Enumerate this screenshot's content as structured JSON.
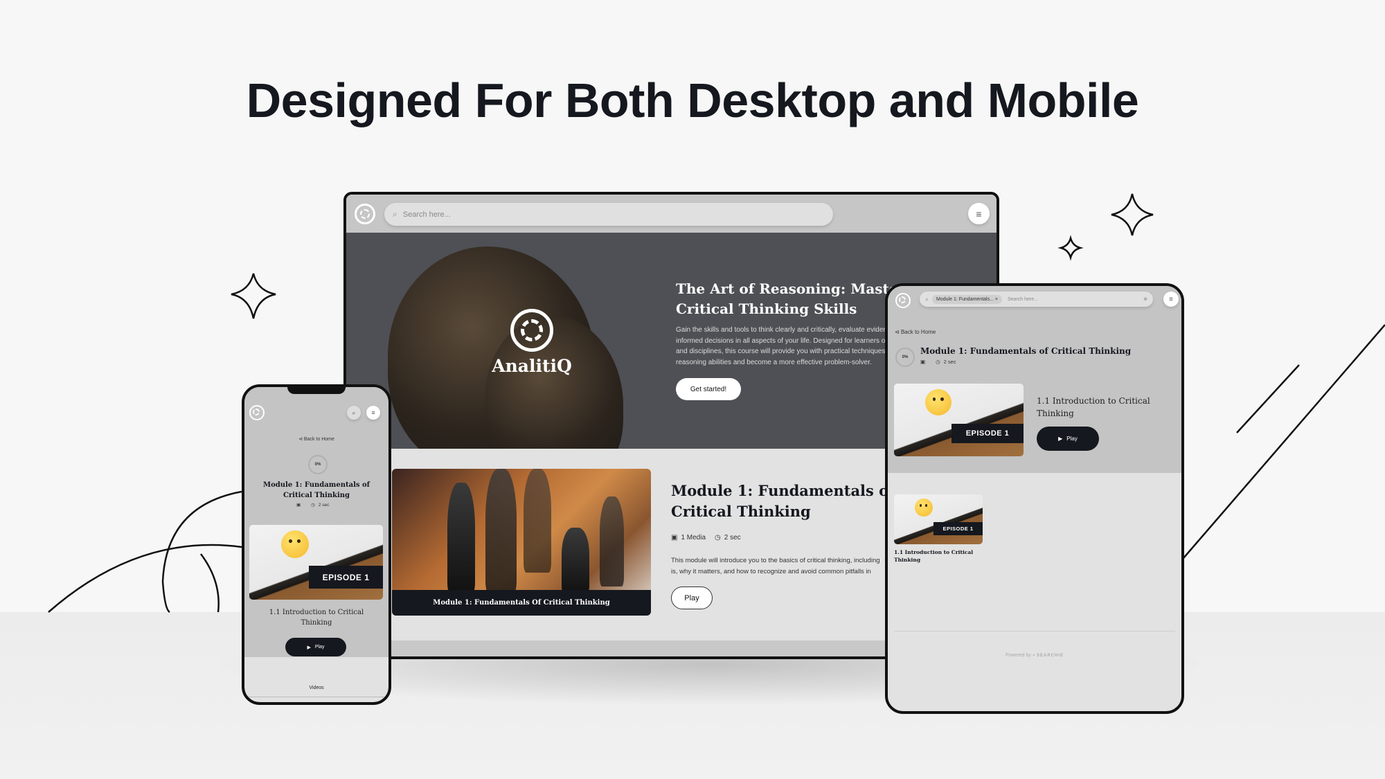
{
  "headline": "Designed For Both Desktop and Mobile",
  "desktop": {
    "search_placeholder": "Search here...",
    "hero": {
      "brand": "AnalitiQ",
      "title_line1": "The Art of Reasoning: Mastering",
      "title_line2": "Critical Thinking Skills",
      "description": [
        "Gain the skills and tools to think clearly and critically, evaluate evidence",
        "informed decisions in all aspects of your life. Designed for learners of all",
        "and disciplines, this course will provide you with practical techniques to",
        "reasoning abilities and become a more effective problem-solver."
      ],
      "cta": "Get started!"
    },
    "module": {
      "image_caption": "Module 1: Fundamentals Of Critical Thinking",
      "title_line1": "Module 1: Fundamentals of",
      "title_line2": "Critical Thinking",
      "media_count": "1 Media",
      "duration": "2 sec",
      "description": [
        "This module will introduce you to the basics of critical thinking, including",
        "is, why it matters, and how to recognize and avoid common pitfalls in"
      ],
      "play": "Play"
    }
  },
  "tablet": {
    "search_chip": "Module 1: Fundamentals...",
    "search_placeholder": "Search here...",
    "back": "Back to Home",
    "progress": "0%",
    "module_title": "Module 1: Fundamentals of Critical Thinking",
    "duration": "2 sec",
    "episode_badge": "EPISODE 1",
    "episode_title_line1": "1.1 Introduction to Critical",
    "episode_title_line2": "Thinking",
    "play": "Play",
    "grid_episode_line1": "1.1 Introduction to Critical",
    "grid_episode_line2": "Thinking",
    "powered_by": "Powered by",
    "powered_brand": "SEARCHIE"
  },
  "phone": {
    "back": "Back to Home",
    "progress": "0%",
    "module_title_line1": "Module 1: Fundamentals of",
    "module_title_line2": "Critical Thinking",
    "duration": "2 sec",
    "episode_badge": "EPISODE 1",
    "episode_title_line1": "1.1 Introduction to Critical",
    "episode_title_line2": "Thinking",
    "play": "Play",
    "tab": "Videos"
  },
  "colors": {
    "dark": "#15181e",
    "hero_bg": "#4e5055",
    "panel_grey": "#c4c4c4",
    "light_grey": "#e2e2e2"
  }
}
